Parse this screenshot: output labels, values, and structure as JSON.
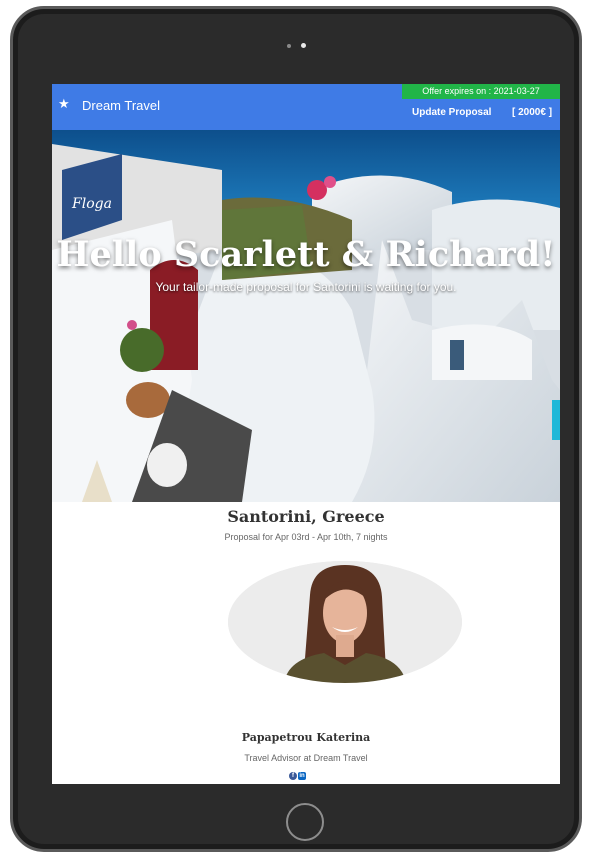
{
  "header": {
    "brand_icon": "star-icon",
    "brand_name": "Dream Travel",
    "offer_text": "Offer expires on : 2021-03-27",
    "update_label": "Update Proposal",
    "price_label": "[ 2000€ ]",
    "colors": {
      "bar": "#3f7be6",
      "offer": "#21b548"
    }
  },
  "hero": {
    "title": "Hello Scarlett & Richard!",
    "subtitle": "Your tailor-made proposal for Santorini is waiting for you.",
    "sign_text": "Floga"
  },
  "proposal": {
    "destination": "Santorini, Greece",
    "dates": "Proposal for Apr 03rd - Apr 10th, 7 nights"
  },
  "agent": {
    "name": "Papapetrou Katerina",
    "role": "Travel Advisor at Dream Travel",
    "social": [
      {
        "icon": "facebook-icon",
        "label": "f"
      },
      {
        "icon": "linkedin-icon",
        "label": "in"
      }
    ]
  }
}
